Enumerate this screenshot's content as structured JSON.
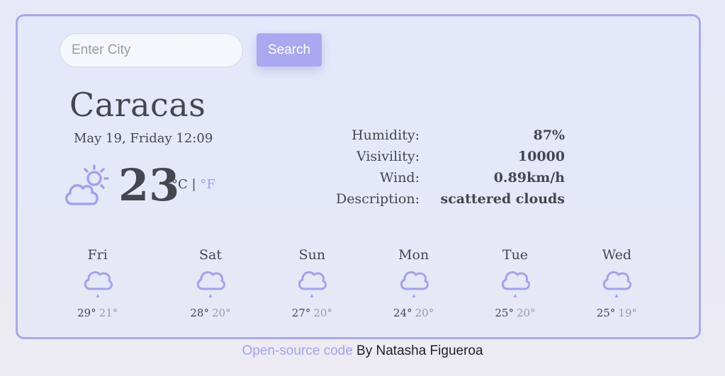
{
  "search": {
    "placeholder": "Enter City",
    "value": "",
    "button_label": "Search"
  },
  "current": {
    "city": "Caracas",
    "date": "May 19, Friday 12:09",
    "temperature": "23",
    "unit_c": "°C",
    "separator": "|",
    "unit_f": "°F",
    "icon": "partly-cloudy-icon"
  },
  "details": [
    {
      "label": "Humidity:",
      "value": "87%"
    },
    {
      "label": "Visivility:",
      "value": "10000"
    },
    {
      "label": "Wind:",
      "value": "0.89km/h"
    },
    {
      "label": "Description:",
      "value": "scattered clouds"
    }
  ],
  "forecast": [
    {
      "day": "Fri",
      "max": "29°",
      "min": "21°",
      "icon": "rain-cloud-icon"
    },
    {
      "day": "Sat",
      "max": "28°",
      "min": "20°",
      "icon": "rain-cloud-icon"
    },
    {
      "day": "Sun",
      "max": "27°",
      "min": "20°",
      "icon": "rain-cloud-icon"
    },
    {
      "day": "Mon",
      "max": "24°",
      "min": "20°",
      "icon": "rain-cloud-icon"
    },
    {
      "day": "Tue",
      "max": "25°",
      "min": "20°",
      "icon": "rain-cloud-icon"
    },
    {
      "day": "Wed",
      "max": "25°",
      "min": "19°",
      "icon": "rain-cloud-icon"
    }
  ],
  "footer": {
    "link_text": "Open-source code",
    "author_text": " By Natasha Figueroa"
  },
  "colors": {
    "accent": "#a9a8f1",
    "text": "#45464f",
    "border": "#a8a8ee",
    "muted": "#9a9aa6"
  }
}
